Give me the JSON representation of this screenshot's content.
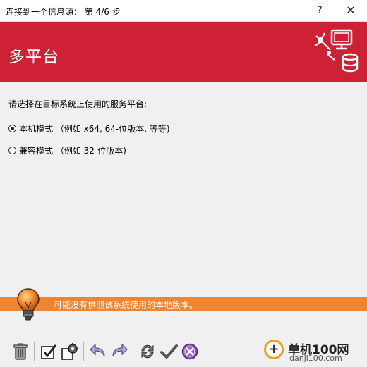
{
  "window": {
    "title": "连接到一个信息源： 第 4/6 步",
    "help_glyph": "?",
    "close_glyph": "✕"
  },
  "banner": {
    "title": "多平台",
    "color": "#cf2136",
    "logo_icon": "network-database-icon"
  },
  "content": {
    "prompt": "请选择在目标系统上使用的服务平台:",
    "options": [
      {
        "label": "本机模式 （例如 x64, 64-位版本, 等等)",
        "selected": true
      },
      {
        "label": "兼容模式 （例如 32-位版本)",
        "selected": false
      }
    ]
  },
  "hint": {
    "text": "可能没有供测试系统使用的本地版本。",
    "color": "#ef8431",
    "icon": "lightbulb-icon"
  },
  "toolbar": {
    "buttons": [
      {
        "name": "trash-icon"
      },
      {
        "name": "check-box-icon"
      },
      {
        "name": "settings-copy-icon"
      },
      {
        "name": "undo-icon"
      },
      {
        "name": "redo-icon"
      },
      {
        "name": "refresh-icon"
      },
      {
        "name": "checkmark-icon"
      },
      {
        "name": "cancel-icon"
      }
    ]
  },
  "watermark": {
    "site_name": "单机100网",
    "url": "danji100.com"
  }
}
